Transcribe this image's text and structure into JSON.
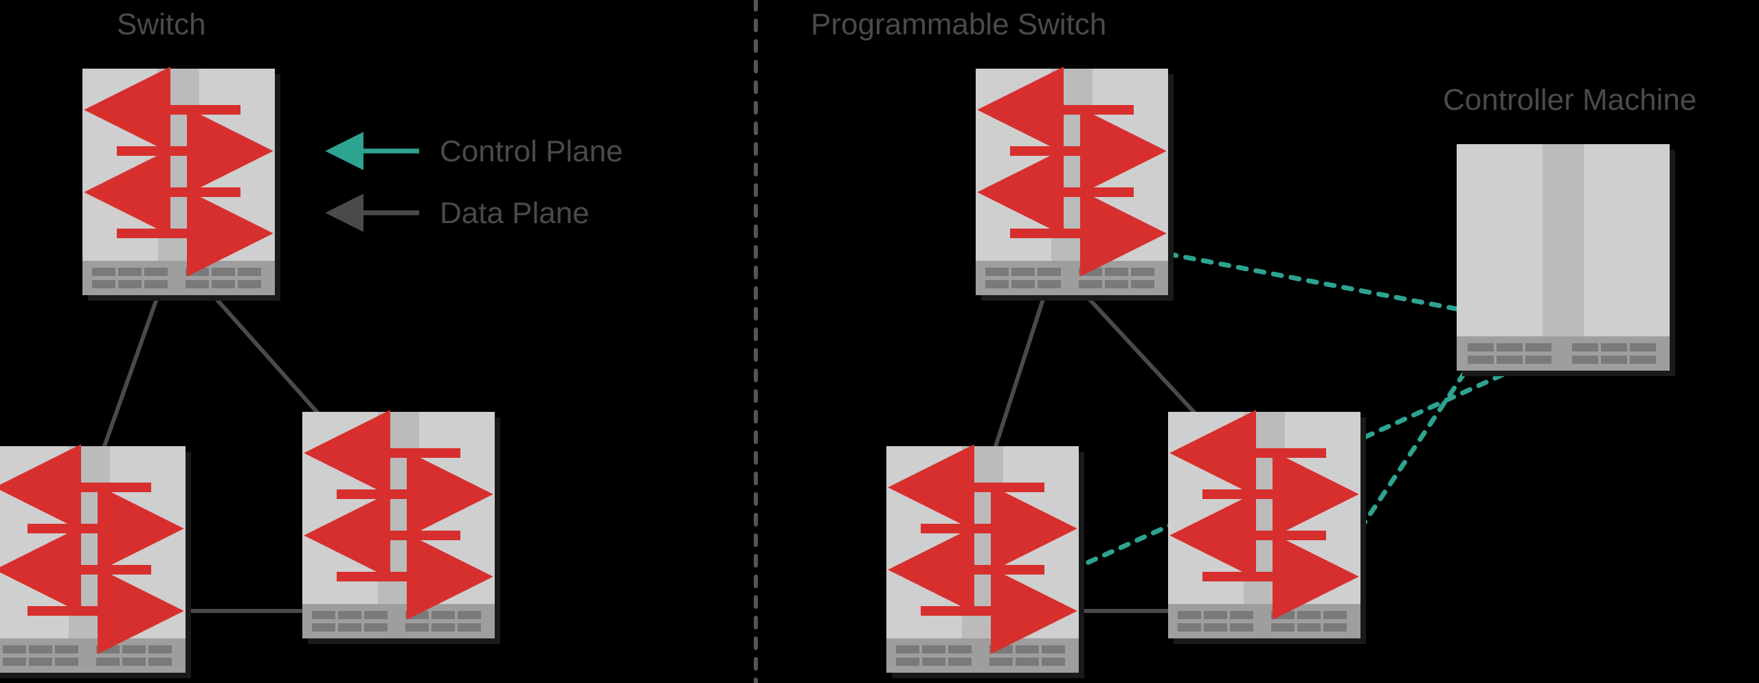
{
  "left": {
    "title": "Switch",
    "legend": {
      "control": "Control Plane",
      "data": "Data Plane"
    }
  },
  "right": {
    "title": "Programmable Switch",
    "controller": "Controller Machine"
  },
  "colors": {
    "accent_teal": "#2DA390",
    "accent_red": "#D72F2E",
    "gray_dark": "#4A4A4A",
    "device_body": "#CFCFCF",
    "device_band": "#BBBBBB",
    "device_base": "#9E9E9E",
    "device_port": "#7A7A7A",
    "divider": "#555555"
  }
}
